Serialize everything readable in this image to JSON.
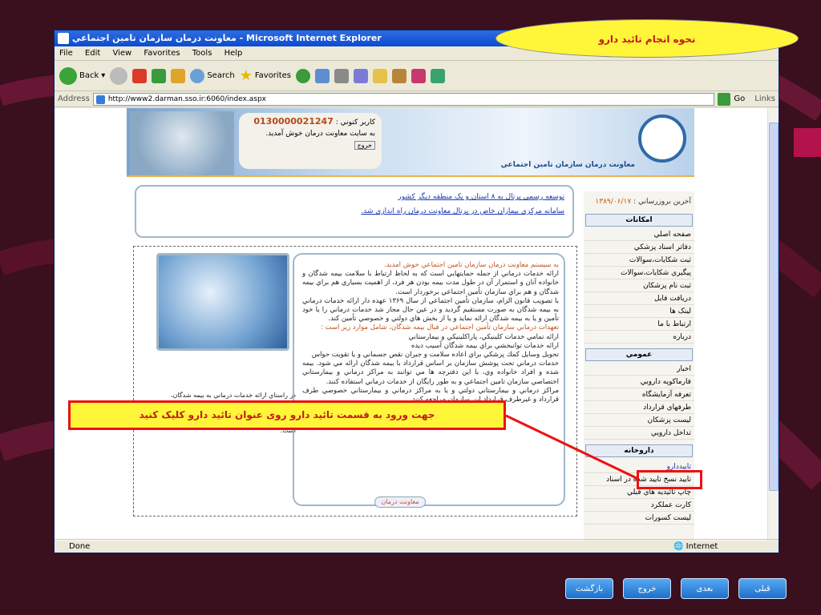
{
  "window_title": "معاونت درمان سازمان تامين اجتماعي - Microsoft Internet Explorer",
  "menu": [
    "File",
    "Edit",
    "View",
    "Favorites",
    "Tools",
    "Help"
  ],
  "toolbar": {
    "back": "Back",
    "search": "Search",
    "favorites": "Favorites",
    "go": "Go",
    "links": "Links"
  },
  "address": {
    "label": "Address",
    "url": "http://www2.darman.sso.ir:6060/index.aspx"
  },
  "header": {
    "user_label": "كاربر كنوني :",
    "user_code": "0130000021247",
    "welcome": "به سايت معاونت درمان خوش آمديد.",
    "logout": "خروج",
    "org": "معاونت درمان سازمان تامين اجتماعي"
  },
  "news": [
    "توسعه رسمي پرتال به ۸ استان و يک منطقه ديگر کشور",
    "سامانه مركزي بيماران خاص در پرتال معاونت درمان راه اندازي شد."
  ],
  "sidebar": {
    "update_label": "آخرين بروزرساني :",
    "update_date": "۱۳۸۹/۰۶/۱۷",
    "sec1": "امكانات",
    "items1": [
      "صفحه اصلي",
      "دفاتر اسناد پزشكي",
      "ثبت شكايات،سوالات",
      "پيگيري شكايات،سوالات",
      "ثبت نام پزشكان",
      "دريافت فايل",
      "لينک ها",
      "ارتباط با ما",
      "درباره"
    ],
    "sec2": "عمومي",
    "items2": [
      "اخبار",
      "فارماكوپه دارويي",
      "تعرفه آزمايشگاه",
      "طرفهاي قرارداد",
      "ليست پزشكان",
      "تداخل دارويي"
    ],
    "sec3": "داروخانه",
    "items3": [
      "تاييددارو",
      "تاييد نسخ تاييد شده در اسناد",
      "چاپ تائيديه هاي قبلي",
      "كارت عملكرد",
      "ليست كسورات"
    ]
  },
  "main": {
    "heading": "به سيستم معاونت درمان سازمان تامين اجتماعي خوش امديد.",
    "p1": "ارائه خدمات درماني از جمله حمايتهايي است كه به لحاظ ارتباط با سلامت بيمه شدگان و خانواده آنان و استمرار آن در طول مدت بيمه بودن هر فرد، از اهميت بسياري هم براي بيمه شدگان و هم براي سازمان تأمين اجتماعي برخوردار است.",
    "p2": "با تصويب قانون الزام، سازمان تأمين اجتماعي از سال ۱۳۶۹ عهده دار ارائه خدمات درماني به بيمه شدگان به صورت مستقيم گرديد و در عين حال مجاز شد خدمات درماني را يا خود تأمين و يا به بيمه شدگان ارائه نمايد و يا از بخش هاي دولتي و خصوصي تأمين كند.",
    "h2": "تعهدات درماني سازمان تأمين اجتماعي در قبال بيمه شدگان، شامل موارد زير است :",
    "l1": "ارائه تمامي خدمات كلينيكي، پاراكلينيكي و بيمارستاني",
    "l2": "ارائه خدمات توانبخشي براي بيمه شدگان آسيب ديده",
    "l3": "تحويل وسايل كمك پزشكي براي اعاده سلامت و جبران نقص جسماني و يا تقويت حواس",
    "p3": "خدمات درماني تحت پوشش سازمان بر اساس قرارداد با بيمه شدگان ارائه مي شود. بيمه شده و افراد خانواده وي، با اين دفترچه ها مي توانند به مراكز درماني و بيمارستاني اختصاصي سازمان تامين اجتماعي و به طور رايگان از خدمات درماني استفاده كنند.",
    "p4": "مراكز درماني و بيمارستاني دولتي و يا به مراكز درماني و بيمارستاني خصوصي طرف قرارداد و غيرطرف قرارداد اين سازمان مراجعه كنند.",
    "more": "معاونت درمان",
    "side_note": "در راستاي ارائه خدمات درماني به بيمه شدگان، سرويسهاي مربوط به مراكز درماني طرف قرارداد و اطلاعات مربوطه را به آنها و بيمه شدگان ارائه ميدهد و در حال گسترش اين سرويسها در خصوص مراكز ملكي است."
  },
  "status": {
    "done": "Done",
    "zone": "Internet"
  },
  "annotations": {
    "title_callout": "نحوه انجام تائيد دارو",
    "instruction": "جهت ورود به قسمت تائيد دارو روی عنوان تائيد دارو كليک كنيد"
  },
  "nav": {
    "prev": "قبلی",
    "next": "بعدی",
    "exit": "خروج",
    "back": "بازگشت"
  }
}
